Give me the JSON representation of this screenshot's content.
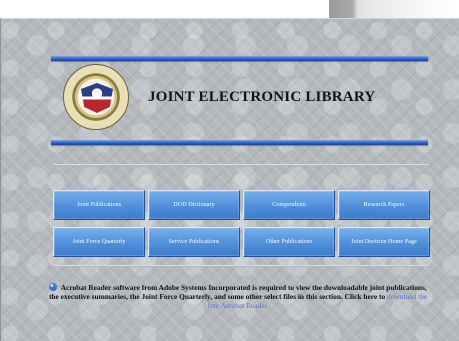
{
  "header": {
    "title": "JOINT ELECTRONIC LIBRARY"
  },
  "nav": {
    "buttons": [
      {
        "label": "Joint Publications"
      },
      {
        "label": "DOD Dictionary"
      },
      {
        "label": "Compendium"
      },
      {
        "label": "Research Papers"
      },
      {
        "label": "Joint Force Quarterly"
      },
      {
        "label": "Service Publications"
      },
      {
        "label": "Other Publications"
      },
      {
        "label": "Joint Doctrine Home Page"
      }
    ]
  },
  "notice": {
    "text": "Acrobat Reader software from Adobe Systems Incorporated is required to view the downloadable joint publications, the executive summaries, the Joint Force Quarterly, and some other select files in this section.  Click here to",
    "link_label": "download the free Acrobat Reader."
  },
  "icons": {
    "seal": "department-of-defense-seal",
    "bullet": "blue-bullet-icon"
  },
  "colors": {
    "panel": "#b4b8bd",
    "button": "#4f8fda",
    "stripe": "#3567c7",
    "link": "#5b74d0"
  }
}
